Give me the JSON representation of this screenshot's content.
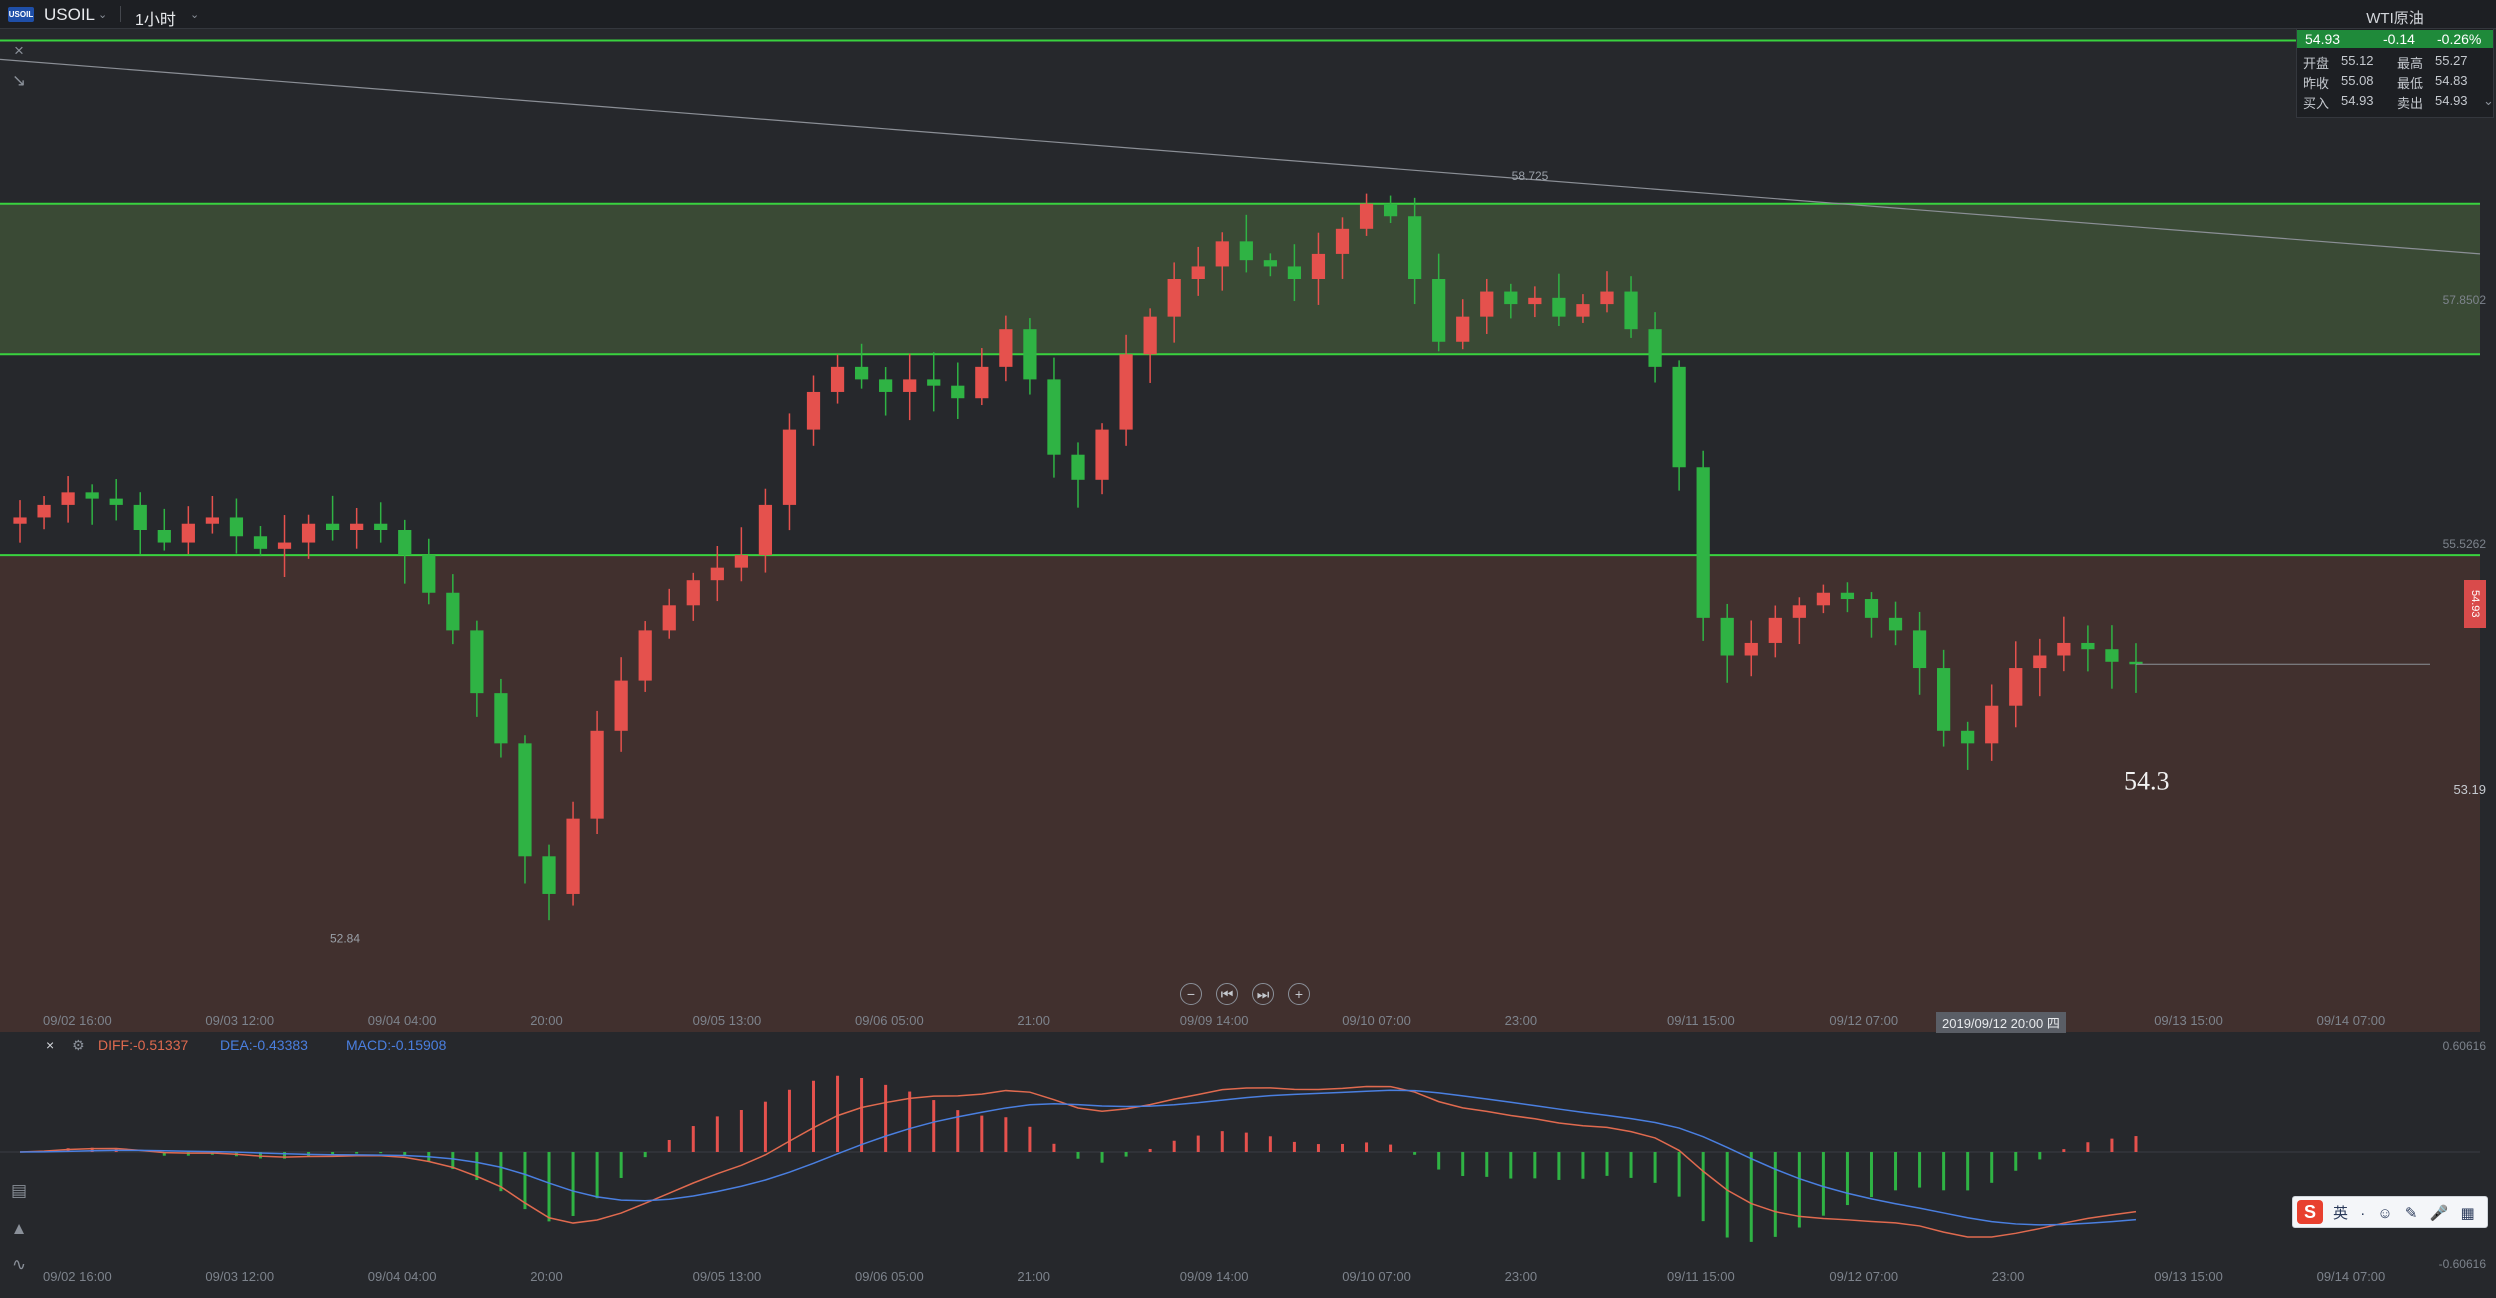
{
  "toolbar": {
    "symbol": "USOIL",
    "logo_text": "USOIL",
    "period": "1小时"
  },
  "quote_panel": {
    "title": "WTI原油",
    "price": "54.93",
    "change": "-0.14",
    "change_pct": "-0.26%",
    "open_label": "开盘",
    "open": "55.12",
    "high_label": "最高",
    "high": "55.27",
    "prev_close_label": "昨收",
    "prev_close": "55.08",
    "low_label": "最低",
    "low": "54.83",
    "bid_label": "买入",
    "bid": "54.93",
    "ask_label": "卖出",
    "ask": "54.93"
  },
  "annotations": {
    "high_marker": "58.725",
    "low_marker": "52.84",
    "support_text": "54.3",
    "price_scale_1": "57.8502",
    "price_scale_2": "55.5262",
    "price_scale_3": "53.19",
    "current_price_tag": "54.93"
  },
  "crosshair_time": "2019/09/12 20:00 四",
  "time_axis": [
    "09/02 16:00",
    "09/03 12:00",
    "09/04 04:00",
    "20:00",
    "09/05 13:00",
    "09/06 05:00",
    "21:00",
    "09/09 14:00",
    "09/10 07:00",
    "23:00",
    "09/11 15:00",
    "09/12 07:00",
    "23:00",
    "09/13 15:00",
    "09/14 07:00"
  ],
  "macd_legend": {
    "diff": "DIFF:-0.51337",
    "dea": "DEA:-0.43383",
    "macd": "MACD:-0.15908",
    "top_value": "0.60616",
    "bottom_value": "-0.60616"
  },
  "ime_bar": {
    "logo": "S",
    "items": [
      "英",
      "·",
      "☺",
      "✎",
      "🎤",
      "▦"
    ]
  },
  "colors": {
    "background": "#26282c",
    "up": "#e5514d",
    "down": "#2fb344",
    "line_green": "#39d23f",
    "zone_green": "#3a4a35",
    "zone_red": "#41302e",
    "diff_line": "#e06a4f",
    "dea_line": "#4a7fe0"
  },
  "chart_data": {
    "type": "candlestick",
    "symbol": "USOIL",
    "timeframe": "1小时",
    "ylim": [
      52.0,
      60.0
    ],
    "horizontal_levels": [
      59.9,
      58.6,
      57.4,
      55.8
    ],
    "zones": [
      {
        "from": 58.6,
        "to": 57.4,
        "color": "green"
      },
      {
        "from": 55.8,
        "to": 52.0,
        "color": "red"
      }
    ],
    "trendline": {
      "from": [
        0,
        59.75
      ],
      "to": [
        1,
        58.2
      ]
    },
    "key_prices": {
      "high": 58.725,
      "low": 52.84,
      "last": 54.93,
      "support": 54.3
    },
    "close_path": [
      56.1,
      56.2,
      56.3,
      56.25,
      56.2,
      56.0,
      55.9,
      56.05,
      56.1,
      55.95,
      55.85,
      55.9,
      56.05,
      56.0,
      56.05,
      56.0,
      55.8,
      55.5,
      55.2,
      54.7,
      54.3,
      53.4,
      53.1,
      53.7,
      54.4,
      54.8,
      55.2,
      55.4,
      55.6,
      55.7,
      55.8,
      56.2,
      56.8,
      57.1,
      57.3,
      57.2,
      57.1,
      57.2,
      57.15,
      57.05,
      57.3,
      57.6,
      57.2,
      56.6,
      56.4,
      56.8,
      57.4,
      57.7,
      58.0,
      58.1,
      58.3,
      58.15,
      58.1,
      58.0,
      58.2,
      58.4,
      58.6,
      58.5,
      58.0,
      57.5,
      57.7,
      57.9,
      57.8,
      57.85,
      57.7,
      57.8,
      57.9,
      57.6,
      57.3,
      56.5,
      55.3,
      55.0,
      55.1,
      55.3,
      55.4,
      55.5,
      55.45,
      55.3,
      55.2,
      54.9,
      54.4,
      54.3,
      54.6,
      54.9,
      55.0,
      55.1,
      55.05,
      54.95,
      54.93
    ]
  }
}
